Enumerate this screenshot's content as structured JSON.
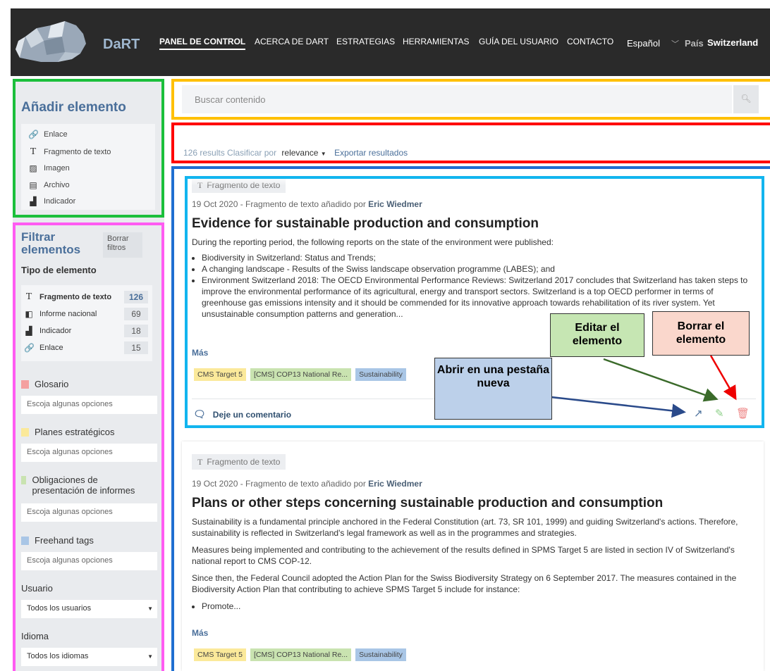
{
  "header": {
    "brand": "DaRT",
    "nav": [
      "PANEL DE CONTROL",
      "ACERCA DE DART",
      "ESTRATEGIAS",
      "HERRAMIENTAS",
      "GUÍA DEL USUARIO",
      "CONTACTO"
    ],
    "language": "Español",
    "country_label": "País",
    "country_value": "Switzerland"
  },
  "add_panel": {
    "title": "Añadir elemento",
    "items": [
      "Enlace",
      "Fragmento de texto",
      "Imagen",
      "Archivo",
      "Indicador"
    ]
  },
  "filter_panel": {
    "title": "Filtrar elementos",
    "clear": "Borrar filtros",
    "type_heading": "Tipo de elemento",
    "types": [
      {
        "label": "Fragmento de texto",
        "count": "126"
      },
      {
        "label": "Informe nacional",
        "count": "69"
      },
      {
        "label": "Indicador",
        "count": "18"
      },
      {
        "label": "Enlace",
        "count": "15"
      }
    ],
    "categories": [
      {
        "label": "Glosario",
        "color": "#f4a0a0",
        "placeholder": "Escoja algunas opciones"
      },
      {
        "label": "Planes estratégicos",
        "color": "#fbe99a",
        "placeholder": "Escoja algunas opciones"
      },
      {
        "label": "Obligaciones de presentación de informes",
        "color": "#c9e3b0",
        "placeholder": "Escoja algunas opciones"
      },
      {
        "label": "Freehand tags",
        "color": "#a9c6e6",
        "placeholder": "Escoja algunas opciones"
      }
    ],
    "user_label": "Usuario",
    "user_value": "Todos los usuarios",
    "lang_label": "Idioma",
    "lang_value": "Todos los idiomas"
  },
  "search": {
    "placeholder": "Buscar contenido"
  },
  "results_bar": {
    "count": "126 results",
    "sort_label": "Clasificar por",
    "sort_value": "relevance",
    "export": "Exportar resultados"
  },
  "cards": [
    {
      "type": "Fragmento de texto",
      "meta": "19 Oct 2020 - Fragmento de texto añadido por",
      "author": "Eric Wiedmer",
      "title": "Evidence for sustainable production and consumption",
      "intro": "During the reporting period, the following reports on the state of the environment were published:",
      "bullets": [
        "Biodiversity in Switzerland: Status and Trends;",
        "A changing landscape - Results of the Swiss landscape observation programme (LABES); and",
        "Environment Switzerland 2018: The OECD Environmental Performance Reviews: Switzerland 2017 concludes that Switzerland has taken steps to improve the environmental performance of its agricultural, energy and transport sectors. Switzerland is a top OECD performer in terms of greenhouse gas emissions intensity and it should be commended for its innovative approach towards rehabilitation of its river system. Yet unsustainable consumption patterns and generation..."
      ],
      "more": "Más",
      "tags": [
        {
          "label": "CMS Target 5",
          "color": "#fbe99a"
        },
        {
          "label": "[CMS] COP13 National Re...",
          "color": "#c9e3b0"
        },
        {
          "label": "Sustainability",
          "color": "#a9c6e6"
        }
      ],
      "comment": "Deje un comentario"
    },
    {
      "type": "Fragmento de texto",
      "meta": "19 Oct 2020 - Fragmento de texto añadido por",
      "author": "Eric Wiedmer",
      "title": "Plans or other steps concerning sustainable production and consumption",
      "paragraphs": [
        "Sustainability is a fundamental principle anchored in the Federal Constitution (art. 73, SR 101, 1999) and guiding Switzerland's actions. Therefore, sustainability is reflected in Switzerland's legal framework as well as in the programmes and strategies.",
        "Measures being implemented and contributing to the achievement of the results defined in SPMS Target 5 are listed in section IV of Switzerland's national report to CMS COP-12.",
        "Since then, the Federal Council adopted the Action Plan for the Swiss Biodiversity Strategy on 6 September 2017. The measures contained in the Biodiversity Action Plan that contributing to achieve SPMS Target 5 include for instance:"
      ],
      "bullet": "Promote...",
      "more": "Más",
      "tags": [
        {
          "label": "CMS Target 5",
          "color": "#fbe99a"
        },
        {
          "label": "[CMS] COP13 National Re...",
          "color": "#c9e3b0"
        },
        {
          "label": "Sustainability",
          "color": "#a9c6e6"
        }
      ]
    }
  ],
  "callouts": {
    "open": "Abrir en una pestaña nueva",
    "edit": "Editar el elemento",
    "delete": "Borrar el elemento"
  },
  "icons": {
    "open": "external-link-icon",
    "edit": "edit-icon",
    "delete": "trash-icon",
    "search": "search-icon"
  }
}
